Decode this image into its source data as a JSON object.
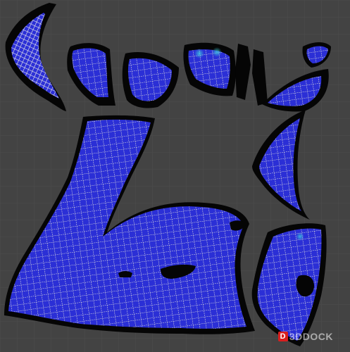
{
  "viewport": {
    "background": "#434343",
    "grid_color": "#4d4d4d",
    "shell_color": "#050505",
    "mesh_fill": "#2b2fd6",
    "mesh_fill_light": "#3a49e0",
    "wire_color": "#dcdcdc",
    "highlight_color": "#36b4c8"
  },
  "watermark": {
    "mark": "D",
    "text": "3DDOCK"
  }
}
